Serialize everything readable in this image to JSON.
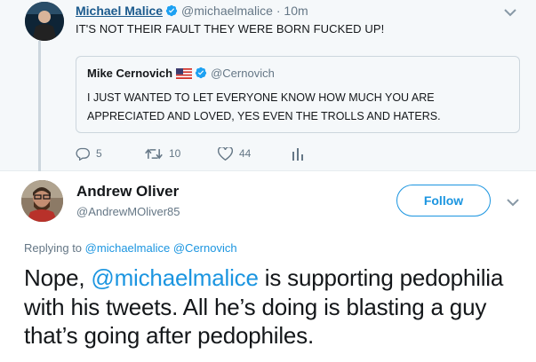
{
  "conversation_tweet": {
    "author_name": "Michael Malice",
    "author_handle": "@michaelmalice",
    "time": "· 10m",
    "text": "IT'S NOT THEIR FAULT THEY WERE BORN FUCKED UP!",
    "quoted_tweet": {
      "author_name": "Mike Cernovich",
      "author_handle": "@Cernovich",
      "text": "I JUST WANTED TO LET EVERYONE KNOW HOW MUCH YOU ARE APPRECIATED AND LOVED, YES EVEN THE TROLLS AND HATERS."
    },
    "actions": {
      "replies": "5",
      "retweets": "10",
      "likes": "44"
    }
  },
  "main_tweet": {
    "author_name": "Andrew Oliver",
    "author_handle": "@AndrewMOliver85",
    "follow_label": "Follow",
    "replying_prefix": "Replying to",
    "replying_to": [
      "@michaelmalice",
      "@Cernovich"
    ],
    "text_mention": "@michaelmalice",
    "text_before": "Nope, ",
    "text_after": " is supporting pedophilia with his tweets. All he’s doing is blasting a guy that’s going after pedophiles."
  },
  "colors": {
    "link": "#1b95e0",
    "muted": "#657786",
    "verified": "#1da1f2",
    "conversation_bg": "#f5f8fa"
  },
  "icons": [
    "verified-badge-icon",
    "us-flag-icon",
    "reply-icon",
    "retweet-icon",
    "like-icon",
    "stats-icon",
    "chevron-down-icon"
  ]
}
